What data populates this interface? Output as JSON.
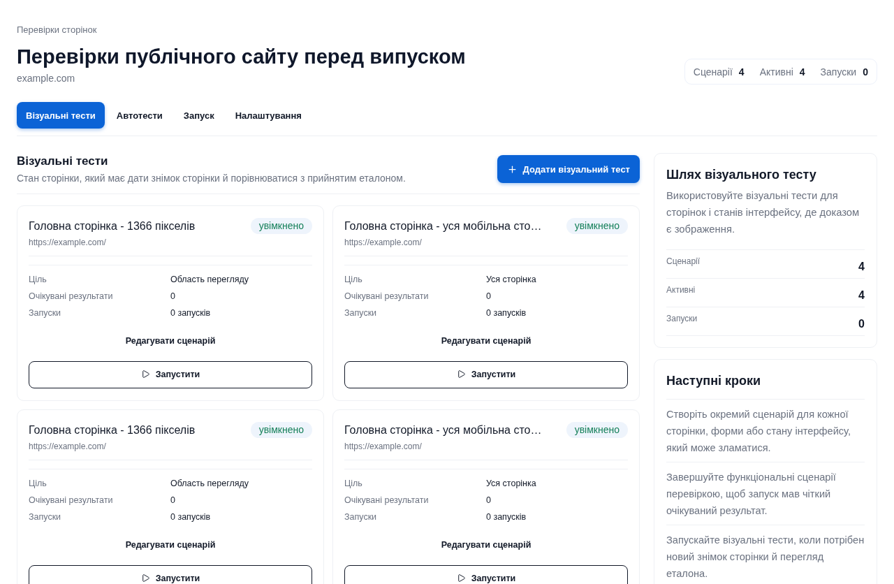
{
  "breadcrumb": "Перевірки сторінок",
  "title": "Перевірки публічного сайту перед випуском",
  "site": "example.com",
  "summary": [
    {
      "label": "Сценарії",
      "value": "4"
    },
    {
      "label": "Активні",
      "value": "4"
    },
    {
      "label": "Запуски",
      "value": "0"
    }
  ],
  "tabs": [
    {
      "label": "Візуальні тести",
      "selected": true
    },
    {
      "label": "Автотести",
      "selected": false
    },
    {
      "label": "Запуск",
      "selected": false
    },
    {
      "label": "Налаштування",
      "selected": false
    }
  ],
  "section": {
    "title": "Візуальні тести",
    "description": "Стан сторінки, який має дати знімок сторінки й порівнюватися з прийнятим еталоном.",
    "add_button": "Додати візуальний тест"
  },
  "tests": [
    {
      "name": "Головна сторінка - 1366 пікселів",
      "status": "увімкнено",
      "enabled": true,
      "url": "https://example.com/",
      "details": [
        {
          "label": "Ціль",
          "value": "Область перегляду"
        },
        {
          "label": "Очікувані результати",
          "value": "0"
        },
        {
          "label": "Запуски",
          "value": "0 запусків"
        }
      ],
      "edit_link": "Редагувати сценарій",
      "run_button": "Запустити"
    },
    {
      "name": "Головна сторінка - уся мобільна сто…",
      "status": "увімкнено",
      "enabled": true,
      "url": "https://example.com/",
      "details": [
        {
          "label": "Ціль",
          "value": "Уся сторінка"
        },
        {
          "label": "Очікувані результати",
          "value": "0"
        },
        {
          "label": "Запуски",
          "value": "0 запусків"
        }
      ],
      "edit_link": "Редагувати сценарій",
      "run_button": "Запустити"
    },
    {
      "name": "Головна сторінка - 1366 пікселів",
      "status": "увімкнено",
      "enabled": true,
      "url": "https://example.com/",
      "details": [
        {
          "label": "Ціль",
          "value": "Область перегляду"
        },
        {
          "label": "Очікувані результати",
          "value": "0"
        },
        {
          "label": "Запуски",
          "value": "0 запусків"
        }
      ],
      "edit_link": "Редагувати сценарій",
      "run_button": "Запустити"
    },
    {
      "name": "Головна сторінка - уся мобільна сто…",
      "status": "увімкнено",
      "enabled": true,
      "url": "https://example.com/",
      "details": [
        {
          "label": "Ціль",
          "value": "Уся сторінка"
        },
        {
          "label": "Очікувані результати",
          "value": "0"
        },
        {
          "label": "Запуски",
          "value": "0 запусків"
        }
      ],
      "edit_link": "Редагувати сценарій",
      "run_button": "Запустити"
    }
  ],
  "path_panel": {
    "title": "Шлях візуального тесту",
    "description": "Використовуйте візуальні тести для сторінок і станів інтерфейсу, де доказом є зображення.",
    "stats": [
      {
        "label": "Сценарії",
        "value": "4"
      },
      {
        "label": "Активні",
        "value": "4"
      },
      {
        "label": "Запуски",
        "value": "0"
      }
    ]
  },
  "next_steps": {
    "title": "Наступні кроки",
    "steps": [
      "Створіть окремий сценарій для кожної сторінки, форми або стану інтерфейсу, який може зламатися.",
      "Завершуйте функціональні сценарії перевіркою, щоб запуск мав чіткий очікуваний результат.",
      "Запускайте візуальні тести, коли потрібен новий знімок сторінки й перегляд еталона."
    ]
  }
}
